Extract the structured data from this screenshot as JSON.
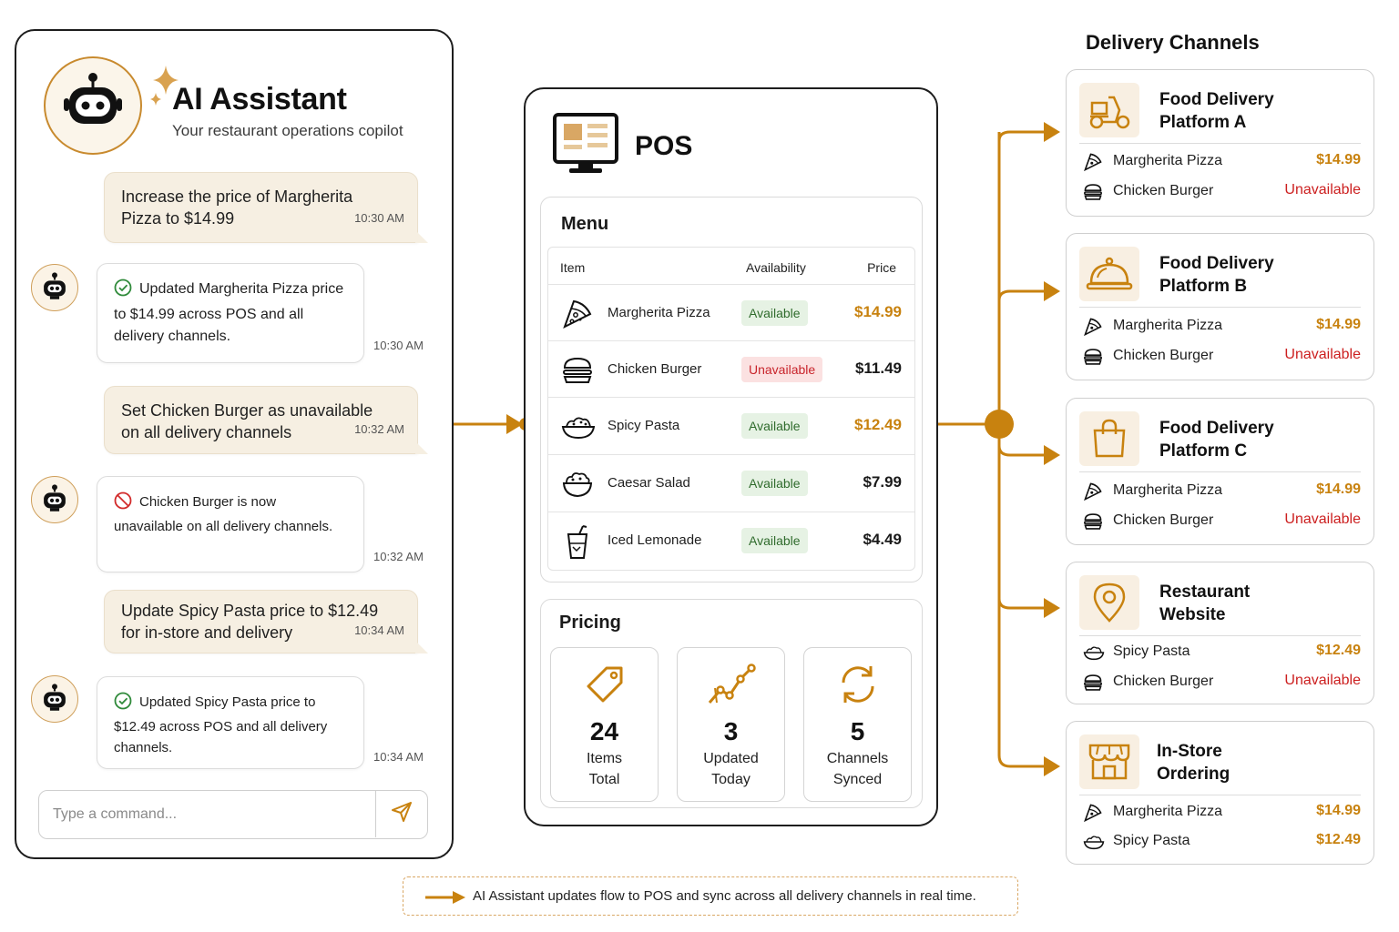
{
  "assistant": {
    "title": "AI Assistant",
    "subtitle": "Your restaurant operations copilot",
    "messages": [
      {
        "from": "user",
        "text": "Increase the price of Margherita Pizza to $14.99",
        "time": "10:30 AM"
      },
      {
        "from": "bot",
        "status": "success",
        "text": "Updated Margherita Pizza price to $14.99 across POS and all delivery channels.",
        "time": "10:30 AM"
      },
      {
        "from": "user",
        "text": "Set Chicken Burger as unavailable on all delivery channels",
        "time": "10:32 AM"
      },
      {
        "from": "bot",
        "status": "blocked",
        "text": "Chicken Burger is now unavailable on all delivery channels.",
        "time": "10:32 AM"
      },
      {
        "from": "user",
        "text": "Update Spicy Pasta price to $12.49 for in-store and delivery",
        "time": "10:34 AM"
      },
      {
        "from": "bot",
        "status": "success",
        "text": "Updated Spicy Pasta price to $12.49 across POS and all delivery channels.",
        "time": "10:34 AM"
      }
    ],
    "command_placeholder": "Type a command..."
  },
  "pos": {
    "title": "POS",
    "menu": {
      "title": "Menu",
      "columns": [
        "Item",
        "Availability",
        "Price"
      ],
      "rows": [
        {
          "item": "Margherita Pizza",
          "availability": "Available",
          "price": "$14.99",
          "icon": "pizza-icon",
          "updated": true
        },
        {
          "item": "Chicken Burger",
          "availability": "Unavailable",
          "price": "$11.49",
          "icon": "burger-icon",
          "updated": false
        },
        {
          "item": "Spicy Pasta",
          "availability": "Available",
          "price": "$12.49",
          "icon": "pasta-icon",
          "updated": true
        },
        {
          "item": "Caesar Salad",
          "availability": "Available",
          "price": "$7.99",
          "icon": "salad-icon",
          "updated": false
        },
        {
          "item": "Iced Lemonade",
          "availability": "Available",
          "price": "$4.49",
          "icon": "drink-icon",
          "updated": false
        }
      ]
    },
    "pricing": {
      "title": "Pricing",
      "stats": [
        {
          "value": "24",
          "label_1": "Items",
          "label_2": "Total",
          "icon": "tag-icon"
        },
        {
          "value": "3",
          "label_1": "Updated",
          "label_2": "Today",
          "icon": "trend-icon"
        },
        {
          "value": "5",
          "label_1": "Channels",
          "label_2": "Synced",
          "icon": "sync-icon"
        }
      ]
    }
  },
  "channels": {
    "heading": "Delivery Channels",
    "list": [
      {
        "name_1": "Food Delivery",
        "name_2": "Platform A",
        "icon": "scooter-icon",
        "items": [
          {
            "name": "Margherita Pizza",
            "value": "$14.99",
            "icon": "pizza-icon"
          },
          {
            "name": "Chicken Burger",
            "value": "Unavailable",
            "icon": "burger-icon"
          }
        ]
      },
      {
        "name_1": "Food Delivery",
        "name_2": "Platform B",
        "icon": "cloche-icon",
        "items": [
          {
            "name": "Margherita Pizza",
            "value": "$14.99",
            "icon": "pizza-icon"
          },
          {
            "name": "Chicken Burger",
            "value": "Unavailable",
            "icon": "burger-icon"
          }
        ]
      },
      {
        "name_1": "Food Delivery",
        "name_2": "Platform C",
        "icon": "bag-icon",
        "items": [
          {
            "name": "Margherita Pizza",
            "value": "$14.99",
            "icon": "pizza-icon"
          },
          {
            "name": "Chicken Burger",
            "value": "Unavailable",
            "icon": "burger-icon"
          }
        ]
      },
      {
        "name_1": "Restaurant",
        "name_2": "Website",
        "icon": "location-pin-icon",
        "items": [
          {
            "name": "Spicy Pasta",
            "value": "$12.49",
            "icon": "pasta-icon"
          },
          {
            "name": "Chicken Burger",
            "value": "Unavailable",
            "icon": "burger-icon"
          }
        ]
      },
      {
        "name_1": "In-Store",
        "name_2": "Ordering",
        "icon": "storefront-icon",
        "items": [
          {
            "name": "Margherita Pizza",
            "value": "$14.99",
            "icon": "pizza-icon"
          },
          {
            "name": "Spicy Pasta",
            "value": "$12.49",
            "icon": "pasta-icon"
          }
        ]
      }
    ]
  },
  "legend": {
    "text": "AI Assistant updates flow to POS and sync across all delivery channels in real time."
  },
  "colors": {
    "accent": "#c8820f",
    "unavailable": "#cc1f1f",
    "available_bg": "#e6f2e4",
    "available_text": "#2f6b2c",
    "unavailable_bg": "#fbe1e1",
    "user_bubble": "#f6efe2"
  }
}
